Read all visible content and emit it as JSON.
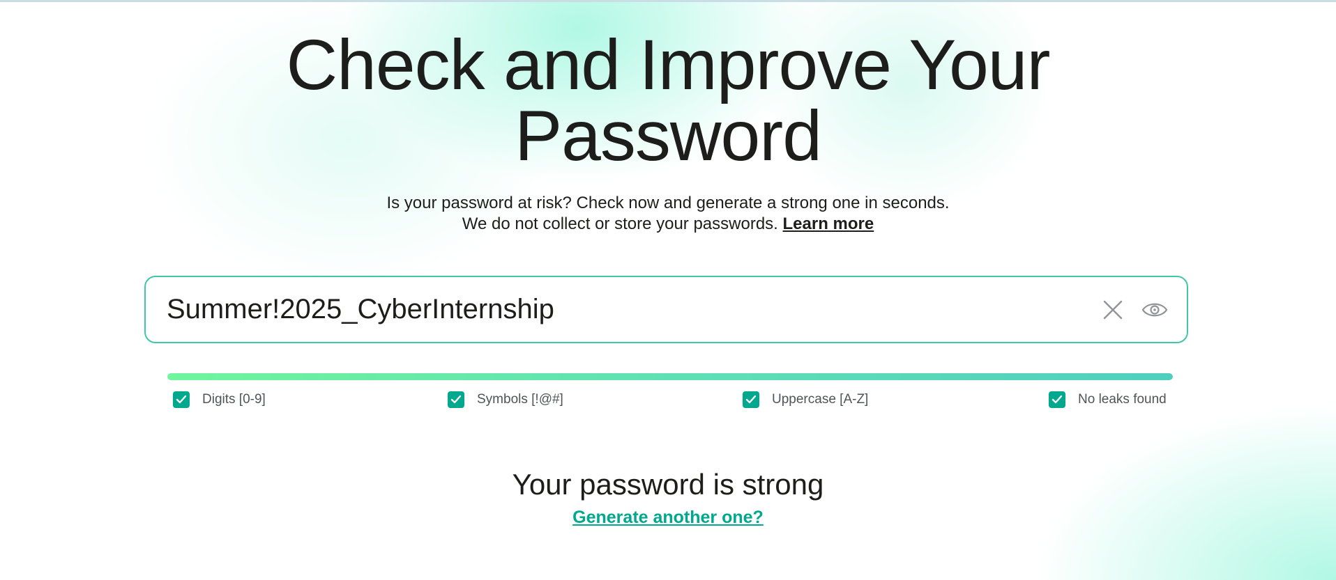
{
  "hero": {
    "title_line1": "Check and Improve Your",
    "title_line2": "Password"
  },
  "subtitle": {
    "line1": "Is your password at risk? Check now and generate a strong one in seconds.",
    "line2": "We do not collect or store your passwords.",
    "learn_more": "Learn more"
  },
  "password_field": {
    "value": "Summer!2025_CyberInternship",
    "clear_icon": "close-icon",
    "visibility_icon": "eye-icon"
  },
  "strength": {
    "level": 1.0,
    "criteria": [
      {
        "label": "Digits [0-9]",
        "checked": true
      },
      {
        "label": "Symbols [!@#]",
        "checked": true
      },
      {
        "label": "Uppercase [A-Z]",
        "checked": true
      },
      {
        "label": "No leaks found",
        "checked": true
      }
    ]
  },
  "result": {
    "title": "Your password is strong",
    "generate_link": "Generate another one?"
  },
  "colors": {
    "accent": "#00a88e",
    "field_border": "#3fc7a9",
    "text": "#1d1d1b",
    "bar_start": "#6ff59b",
    "bar_end": "#4fd0be"
  }
}
